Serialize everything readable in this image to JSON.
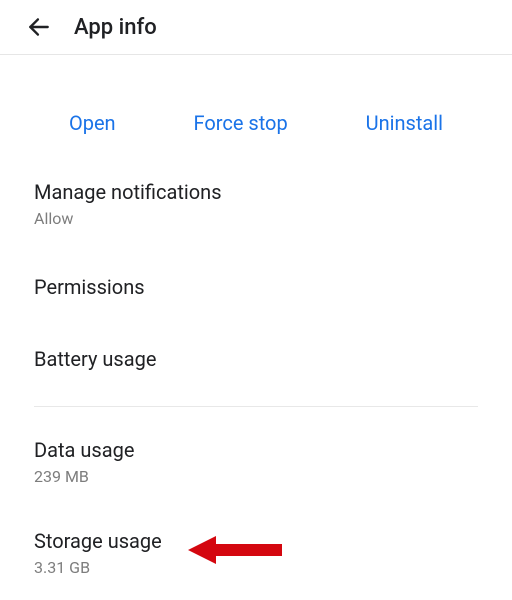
{
  "header": {
    "title": "App info"
  },
  "actions": {
    "open": "Open",
    "force_stop": "Force stop",
    "uninstall": "Uninstall"
  },
  "settings": {
    "notifications": {
      "label": "Manage notifications",
      "sub": "Allow"
    },
    "permissions": {
      "label": "Permissions"
    },
    "battery": {
      "label": "Battery usage"
    },
    "data_usage": {
      "label": "Data usage",
      "sub": "239 MB"
    },
    "storage": {
      "label": "Storage usage",
      "sub": "3.31 GB"
    }
  }
}
